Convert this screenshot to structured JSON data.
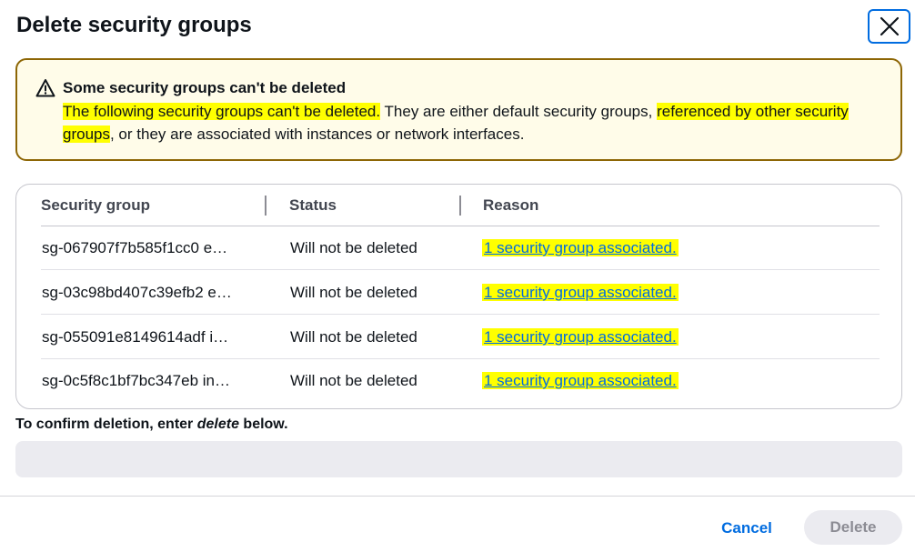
{
  "modal": {
    "title": "Delete security groups",
    "close_icon": "close-icon"
  },
  "alert": {
    "icon": "warning-icon",
    "title": "Some security groups can't be deleted",
    "body_part1": "The following security groups can't be deleted.",
    "body_part2": " They are either default security groups, ",
    "body_part3": "referenced by other security groups",
    "body_part4": ", or they are associated with instances or network interfaces."
  },
  "table": {
    "headers": [
      "Security group",
      "Status",
      "Reason"
    ],
    "rows": [
      {
        "group": "sg-067907f7b585f1cc0 e…",
        "status": "Will not be deleted",
        "reason": "1 security group associated."
      },
      {
        "group": "sg-03c98bd407c39efb2 e…",
        "status": "Will not be deleted",
        "reason": "1 security group associated."
      },
      {
        "group": "sg-055091e8149614adf i…",
        "status": "Will not be deleted",
        "reason": "1 security group associated."
      },
      {
        "group": "sg-0c5f8c1bf7bc347eb in…",
        "status": "Will not be deleted",
        "reason": "1 security group associated."
      }
    ]
  },
  "confirm": {
    "label_prefix": "To confirm deletion, enter ",
    "label_keyword": "delete",
    "label_suffix": " below.",
    "value": "",
    "placeholder": ""
  },
  "footer": {
    "cancel_label": "Cancel",
    "delete_label": "Delete"
  },
  "colors": {
    "accent": "#006ce0",
    "warning_border": "#8d6605",
    "warning_bg": "#fffce9",
    "highlight": "#ffff00"
  }
}
